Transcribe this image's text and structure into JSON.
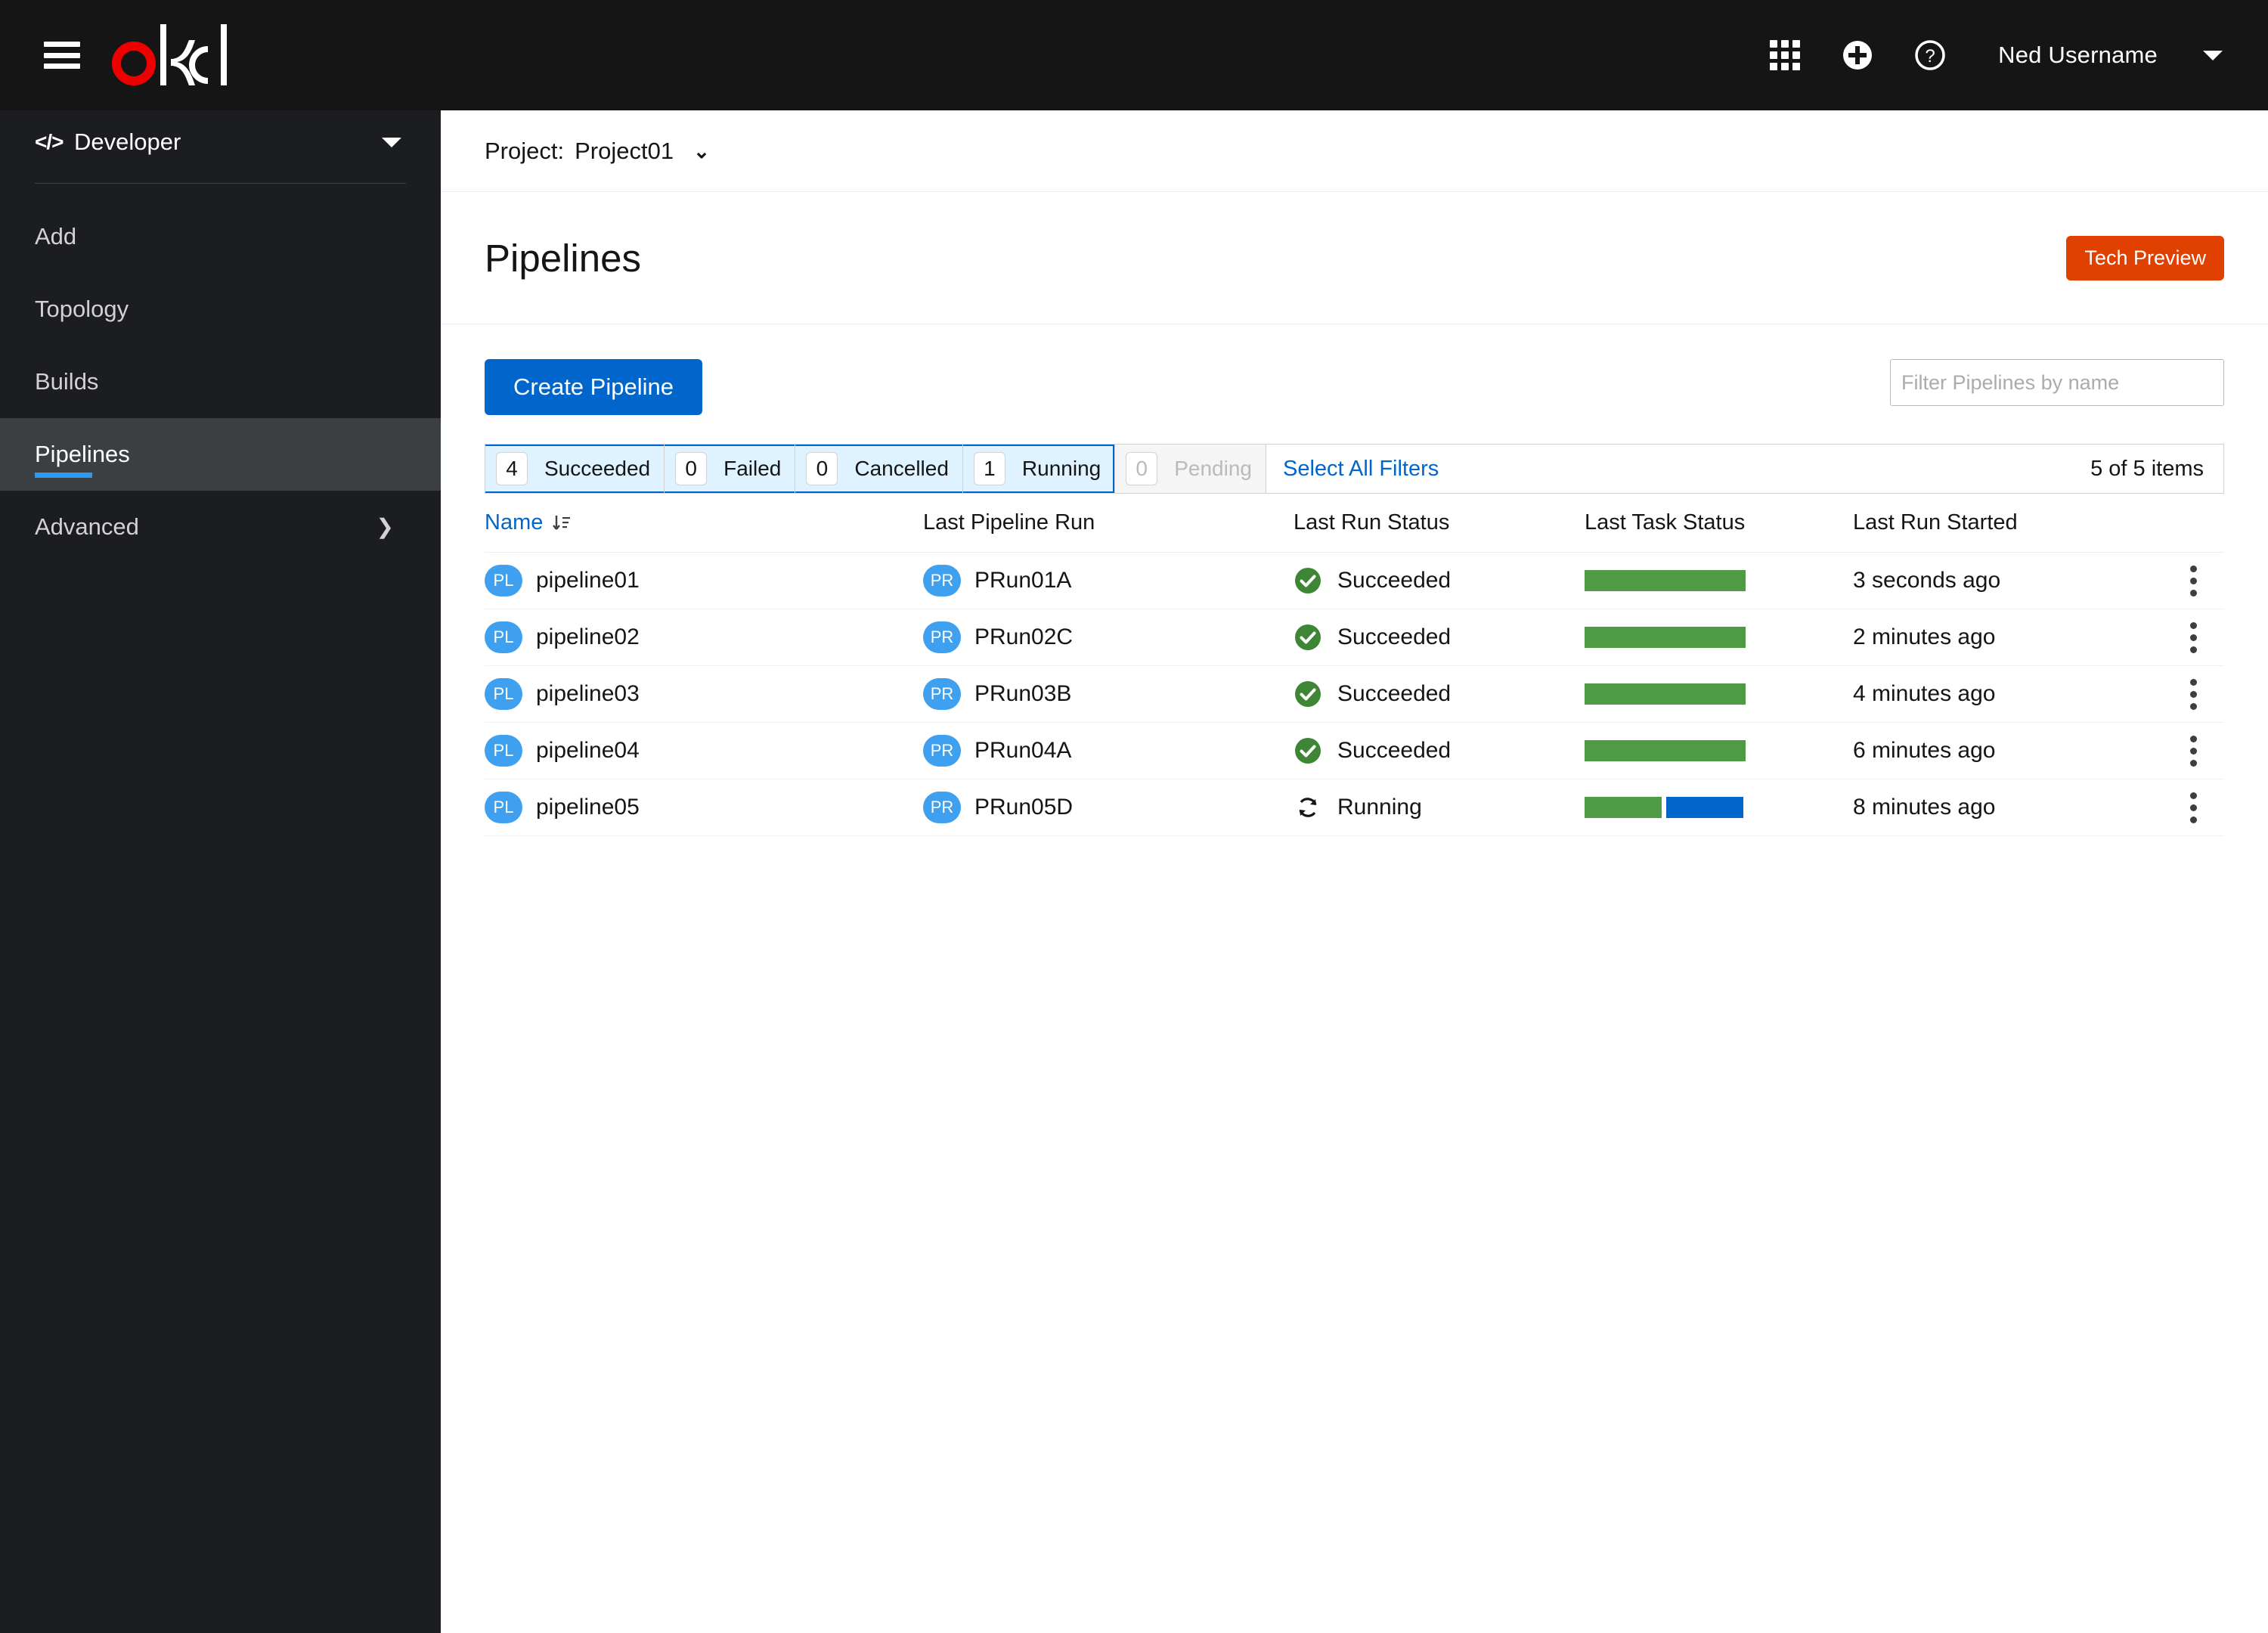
{
  "masthead": {
    "menu_icon": "hamburger-icon",
    "logo_text": "okd",
    "logo_accent_color": "#ee0000",
    "icons": [
      {
        "name": "applications-grid-icon",
        "label": "Applications"
      },
      {
        "name": "plus-circle-icon",
        "label": "Add"
      },
      {
        "name": "question-circle-icon",
        "label": "Help"
      }
    ],
    "user_name": "Ned Username",
    "user_caret": "caret-down-icon"
  },
  "sidebar": {
    "perspective": {
      "icon": "code-icon",
      "label": "Developer",
      "caret": "caret-down-icon"
    },
    "items": [
      {
        "label": "Add",
        "active": false,
        "chevron": false
      },
      {
        "label": "Topology",
        "active": false,
        "chevron": false
      },
      {
        "label": "Builds",
        "active": false,
        "chevron": false
      },
      {
        "label": "Pipelines",
        "active": true,
        "chevron": false
      },
      {
        "label": "Advanced",
        "active": false,
        "chevron": true
      }
    ],
    "active_underline_color": "#2b9af3"
  },
  "project_bar": {
    "label": "Project:",
    "value": "Project01",
    "caret": "chevron-down-icon"
  },
  "page": {
    "title": "Pipelines",
    "badge": {
      "label": "Tech Preview",
      "color": "#e04000"
    }
  },
  "toolbar": {
    "create_label": "Create Pipeline",
    "create_color": "#0066cc",
    "filter_placeholder": "Filter Pipelines by name",
    "filter_value": ""
  },
  "status_filters": {
    "chips": [
      {
        "count": "4",
        "label": "Succeeded",
        "selected": true,
        "disabled": false
      },
      {
        "count": "0",
        "label": "Failed",
        "selected": true,
        "disabled": false
      },
      {
        "count": "0",
        "label": "Cancelled",
        "selected": true,
        "disabled": false
      },
      {
        "count": "1",
        "label": "Running",
        "selected": true,
        "disabled": false
      },
      {
        "count": "0",
        "label": "Pending",
        "selected": false,
        "disabled": true
      }
    ],
    "select_all_label": "Select All Filters",
    "item_count_label": "5 of 5 items"
  },
  "table": {
    "columns": [
      {
        "label": "Name",
        "sortable": true,
        "sort_icon": "sort-amount-down-icon"
      },
      {
        "label": "Last Pipeline Run",
        "sortable": false
      },
      {
        "label": "Last Run Status",
        "sortable": false
      },
      {
        "label": "Last Task Status",
        "sortable": false
      },
      {
        "label": "Last Run Started",
        "sortable": false
      },
      {
        "label": "",
        "sortable": false
      }
    ],
    "rows": [
      {
        "name_badge": "PL",
        "name": "pipeline01",
        "run_badge": "PR",
        "run": "PRun01A",
        "status": "Succeeded",
        "status_icon": "check-circle-icon",
        "status_color": "#3e8635",
        "tasks": [
          {
            "color": "#4f9a45",
            "width_pct": 100
          }
        ],
        "started": "3 seconds ago",
        "kebab": "kebab-menu-icon"
      },
      {
        "name_badge": "PL",
        "name": "pipeline02",
        "run_badge": "PR",
        "run": "PRun02C",
        "status": "Succeeded",
        "status_icon": "check-circle-icon",
        "status_color": "#3e8635",
        "tasks": [
          {
            "color": "#4f9a45",
            "width_pct": 100
          }
        ],
        "started": "2 minutes ago",
        "kebab": "kebab-menu-icon"
      },
      {
        "name_badge": "PL",
        "name": "pipeline03",
        "run_badge": "PR",
        "run": "PRun03B",
        "status": "Succeeded",
        "status_icon": "check-circle-icon",
        "status_color": "#3e8635",
        "tasks": [
          {
            "color": "#4f9a45",
            "width_pct": 100
          }
        ],
        "started": "4 minutes ago",
        "kebab": "kebab-menu-icon"
      },
      {
        "name_badge": "PL",
        "name": "pipeline04",
        "run_badge": "PR",
        "run": "PRun04A",
        "status": "Succeeded",
        "status_icon": "check-circle-icon",
        "status_color": "#3e8635",
        "tasks": [
          {
            "color": "#4f9a45",
            "width_pct": 100
          }
        ],
        "started": "6 minutes ago",
        "kebab": "kebab-menu-icon"
      },
      {
        "name_badge": "PL",
        "name": "pipeline05",
        "run_badge": "PR",
        "run": "PRun05D",
        "status": "Running",
        "status_icon": "sync-icon",
        "status_color": "#151515",
        "tasks": [
          {
            "color": "#4f9a45",
            "width_pct": 48
          },
          {
            "color": "#0066cc",
            "width_pct": 48
          }
        ],
        "started": "8 minutes ago",
        "kebab": "kebab-menu-icon"
      }
    ]
  }
}
